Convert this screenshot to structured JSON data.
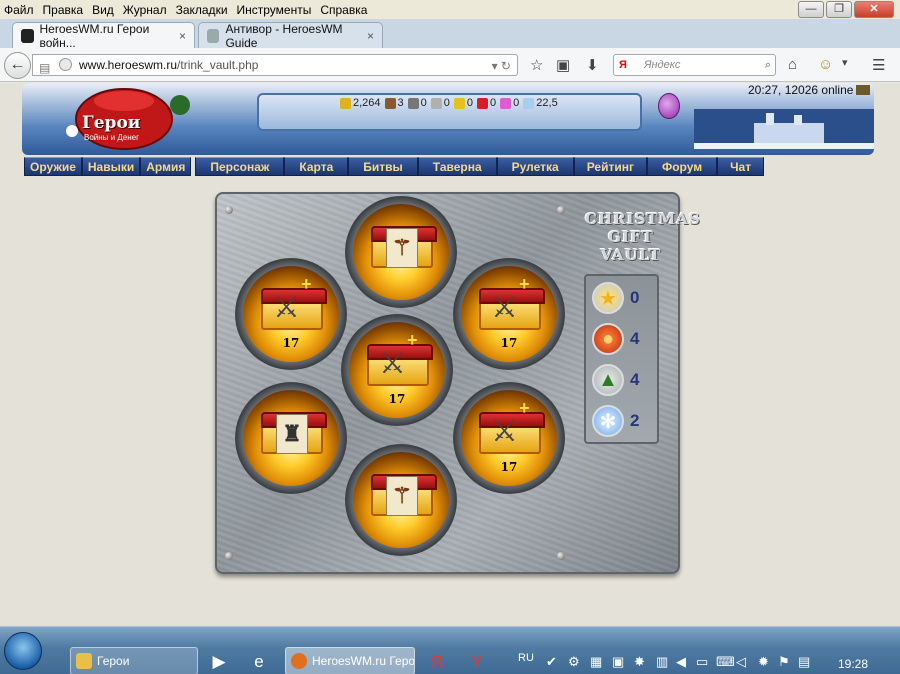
{
  "menubar": {
    "items": [
      "Файл",
      "Правка",
      "Вид",
      "Журнал",
      "Закладки",
      "Инструменты",
      "Справка"
    ]
  },
  "window_controls": {
    "minimize": "—",
    "restore": "❐",
    "close": "✕"
  },
  "tabs": [
    {
      "label": "HeroesWM.ru Герои войн...",
      "active": true
    },
    {
      "label": "Антивор - HeroesWM Guide",
      "active": false
    }
  ],
  "tab_close": "×",
  "new_tab": "+",
  "navbar": {
    "back": "←",
    "url_host": "www.heroeswm.ru",
    "url_path": "/trink_vault.php",
    "search_engine": "Я",
    "search_placeholder": "Яндекс",
    "icons": [
      "star-icon",
      "clipboard-icon",
      "download-icon",
      "home-icon",
      "smiley-icon",
      "menu-icon"
    ]
  },
  "header": {
    "logo_text": "Герои",
    "logo_sub": "Войны и Денег",
    "resources": [
      {
        "name": "gold",
        "value": "2,264",
        "color": "#e0b020"
      },
      {
        "name": "wood",
        "value": "3",
        "color": "#8a5a2a"
      },
      {
        "name": "ore",
        "value": "0",
        "color": "#777777"
      },
      {
        "name": "mercury",
        "value": "0",
        "color": "#b0b0b0"
      },
      {
        "name": "sulfur",
        "value": "0",
        "color": "#e5c21a"
      },
      {
        "name": "crystals",
        "value": "0",
        "color": "#d0202a"
      },
      {
        "name": "gems",
        "value": "0",
        "color": "#e05bd0"
      },
      {
        "name": "diamonds",
        "value": "22,5",
        "color": "#a8cfee"
      }
    ],
    "time_online": "20:27, 12026 online"
  },
  "menu": {
    "group1": [
      "Оружие",
      "Навыки",
      "Армия"
    ],
    "group2": [
      "Персонаж",
      "Карта",
      "Битвы",
      "Таверна",
      "Рулетка",
      "Рейтинг",
      "Форум",
      "Чат"
    ]
  },
  "vault": {
    "title_line1": "CHRISTMAS",
    "title_line2": "GIFT VAULT",
    "slots": [
      {
        "kind": "staff",
        "qty": ""
      },
      {
        "kind": "swords",
        "qty": "17"
      },
      {
        "kind": "swords",
        "qty": "17"
      },
      {
        "kind": "swords",
        "qty": "17"
      },
      {
        "kind": "armor",
        "qty": ""
      },
      {
        "kind": "swords",
        "qty": "17"
      },
      {
        "kind": "staff",
        "qty": ""
      }
    ],
    "counters": [
      {
        "icon": "star-icon",
        "symbol": "★",
        "value": "0",
        "color": "#f2b21a"
      },
      {
        "icon": "lantern-icon",
        "symbol": "●",
        "value": "4",
        "color": "#e2501a"
      },
      {
        "icon": "tree-icon",
        "symbol": "▲",
        "value": "4",
        "color": "#2f7a2a"
      },
      {
        "icon": "snowflake-icon",
        "symbol": "✻",
        "value": "2",
        "color": "#6fa8ee"
      }
    ]
  },
  "taskbar": {
    "items": [
      {
        "label": "Герои",
        "active": false
      },
      {
        "label": "HeroesWM.ru Геро...",
        "active": true
      }
    ],
    "lang": "RU",
    "clock": "19:28"
  }
}
